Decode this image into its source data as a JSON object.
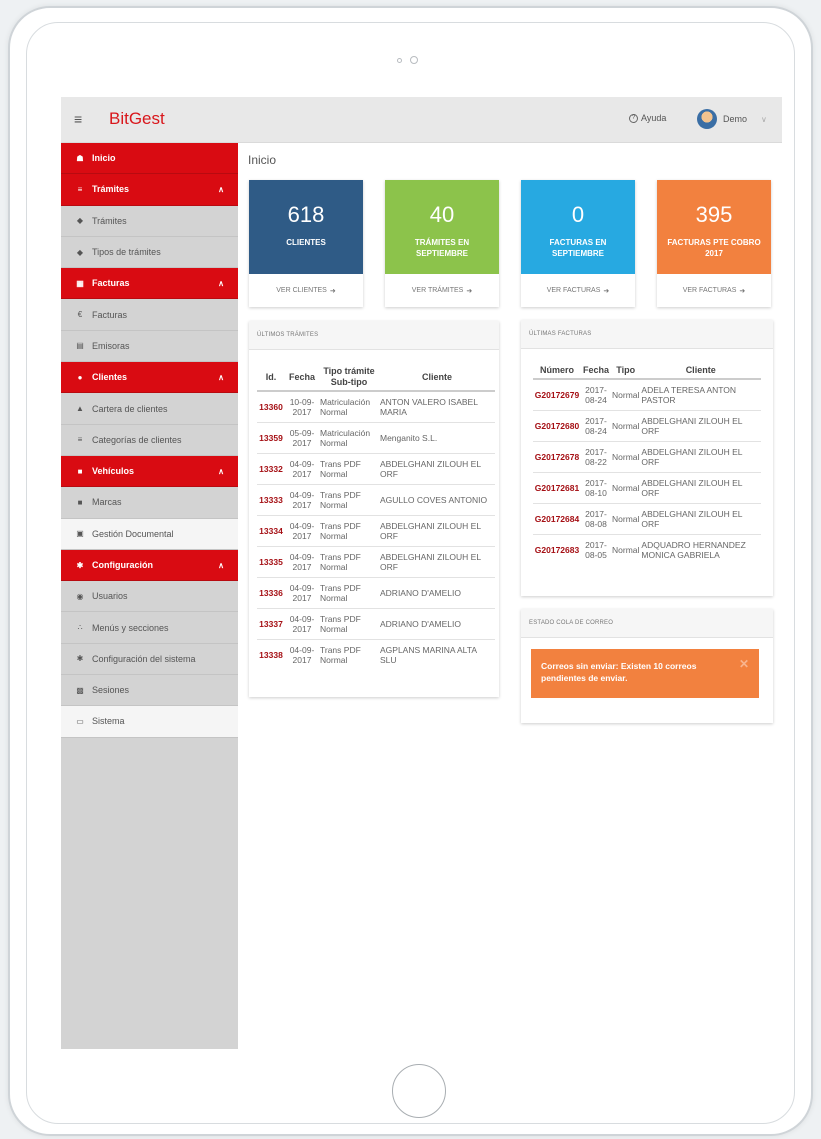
{
  "app": {
    "title": "BitGest",
    "menu_icon": "hamburger-icon"
  },
  "topbar": {
    "help_label": "Ayuda",
    "user_label": "Demo",
    "help_icon": "question-circle-icon"
  },
  "sidebar": {
    "items": [
      {
        "label": "Inicio",
        "icon": "home-icon",
        "type": "header"
      },
      {
        "label": "Trámites",
        "icon": "list-icon",
        "type": "header",
        "expanded": true
      },
      {
        "label": "Trámites",
        "icon": "tag-icon",
        "type": "sub"
      },
      {
        "label": "Tipos de trámites",
        "icon": "tag-icon",
        "type": "sub"
      },
      {
        "label": "Facturas",
        "icon": "money-icon",
        "type": "header",
        "expanded": true
      },
      {
        "label": "Facturas",
        "icon": "euro-icon",
        "type": "sub"
      },
      {
        "label": "Emisoras",
        "icon": "card-icon",
        "type": "sub"
      },
      {
        "label": "Clientes",
        "icon": "users-icon",
        "type": "header",
        "expanded": true
      },
      {
        "label": "Cartera de clientes",
        "icon": "user-icon",
        "type": "sub"
      },
      {
        "label": "Categorías de clientes",
        "icon": "list-icon",
        "type": "sub"
      },
      {
        "label": "Vehículos",
        "icon": "car-icon",
        "type": "header",
        "expanded": true
      },
      {
        "label": "Marcas",
        "icon": "car-icon",
        "type": "sub"
      },
      {
        "label": "Gestión Documental",
        "icon": "book-icon",
        "type": "white"
      },
      {
        "label": "Configuración",
        "icon": "gear-icon",
        "type": "header",
        "expanded": true
      },
      {
        "label": "Usuarios",
        "icon": "user-circle-icon",
        "type": "sub"
      },
      {
        "label": "Menús y secciones",
        "icon": "sitemap-icon",
        "type": "sub"
      },
      {
        "label": "Configuración del sistema",
        "icon": "gear-icon",
        "type": "sub"
      },
      {
        "label": "Sesiones",
        "icon": "file-icon",
        "type": "sub"
      },
      {
        "label": "Sistema",
        "icon": "desktop-icon",
        "type": "white"
      }
    ]
  },
  "main": {
    "title": "Inicio",
    "stats": [
      {
        "value": "618",
        "label": "CLIENTES",
        "link": "VER CLIENTES",
        "color": "#2f5b86"
      },
      {
        "value": "40",
        "label": "TRÁMITES EN SEPTIEMBRE",
        "link": "VER TRÁMITES",
        "color": "#8cc34b"
      },
      {
        "value": "0",
        "label": "FACTURAS EN SEPTIEMBRE",
        "link": "VER FACTURAS",
        "color": "#27a9e1"
      },
      {
        "value": "395",
        "label": "FACTURAS PTE COBRO 2017",
        "link": "VER FACTURAS",
        "color": "#f2813f"
      }
    ],
    "tramites": {
      "title": "ÚLTIMOS TRÁMITES",
      "headers": {
        "id": "Id.",
        "fecha": "Fecha",
        "tipo": "Tipo trámite",
        "subtipo": "Sub-tipo",
        "cliente": "Cliente"
      },
      "rows": [
        {
          "id": "13360",
          "fecha": "10-09-2017",
          "tipo": "Matriculación",
          "subtipo": "Normal",
          "cliente": "ANTON VALERO ISABEL MARIA"
        },
        {
          "id": "13359",
          "fecha": "05-09-2017",
          "tipo": "Matriculación",
          "subtipo": "Normal",
          "cliente": "Menganito S.L."
        },
        {
          "id": "13332",
          "fecha": "04-09-2017",
          "tipo": "Trans PDF",
          "subtipo": "Normal",
          "cliente": "ABDELGHANI ZILOUH EL ORF"
        },
        {
          "id": "13333",
          "fecha": "04-09-2017",
          "tipo": "Trans PDF",
          "subtipo": "Normal",
          "cliente": "AGULLO COVES ANTONIO"
        },
        {
          "id": "13334",
          "fecha": "04-09-2017",
          "tipo": "Trans PDF",
          "subtipo": "Normal",
          "cliente": "ABDELGHANI ZILOUH EL ORF"
        },
        {
          "id": "13335",
          "fecha": "04-09-2017",
          "tipo": "Trans PDF",
          "subtipo": "Normal",
          "cliente": "ABDELGHANI ZILOUH EL ORF"
        },
        {
          "id": "13336",
          "fecha": "04-09-2017",
          "tipo": "Trans PDF",
          "subtipo": "Normal",
          "cliente": "ADRIANO D'AMELIO"
        },
        {
          "id": "13337",
          "fecha": "04-09-2017",
          "tipo": "Trans PDF",
          "subtipo": "Normal",
          "cliente": "ADRIANO D'AMELIO"
        },
        {
          "id": "13338",
          "fecha": "04-09-2017",
          "tipo": "Trans PDF",
          "subtipo": "Normal",
          "cliente": "AGPLANS MARINA ALTA SLU"
        }
      ]
    },
    "facturas": {
      "title": "ÚLTIMAS FACTURAS",
      "headers": {
        "numero": "Número",
        "fecha": "Fecha",
        "tipo": "Tipo",
        "cliente": "Cliente"
      },
      "rows": [
        {
          "numero": "G20172679",
          "fecha": "2017-08-24",
          "tipo": "Normal",
          "cliente": "ADELA TERESA ANTON PASTOR"
        },
        {
          "numero": "G20172680",
          "fecha": "2017-08-24",
          "tipo": "Normal",
          "cliente": "ABDELGHANI ZILOUH EL ORF"
        },
        {
          "numero": "G20172678",
          "fecha": "2017-08-22",
          "tipo": "Normal",
          "cliente": "ABDELGHANI ZILOUH EL ORF"
        },
        {
          "numero": "G20172681",
          "fecha": "2017-08-10",
          "tipo": "Normal",
          "cliente": "ABDELGHANI ZILOUH EL ORF"
        },
        {
          "numero": "G20172684",
          "fecha": "2017-08-08",
          "tipo": "Normal",
          "cliente": "ABDELGHANI ZILOUH EL ORF"
        },
        {
          "numero": "G20172683",
          "fecha": "2017-08-05",
          "tipo": "Normal",
          "cliente": "ADQUADRO HERNANDEZ MONICA GABRIELA"
        }
      ]
    },
    "correo": {
      "title": "ESTADO COLA DE CORREO",
      "alert": "Correos sin enviar: Existen 10 correos pendientes de enviar."
    }
  }
}
